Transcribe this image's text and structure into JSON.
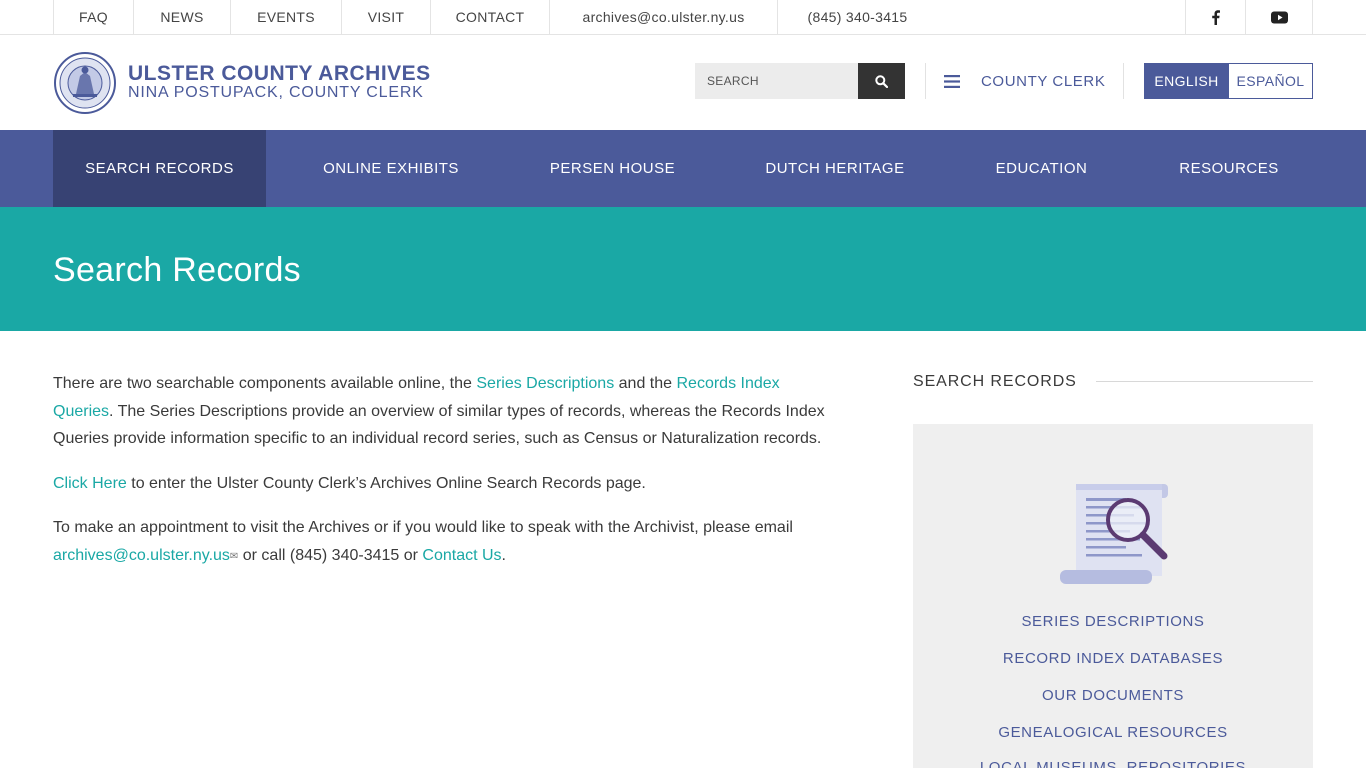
{
  "topbar": {
    "links": [
      "FAQ",
      "NEWS",
      "EVENTS",
      "VISIT",
      "CONTACT"
    ],
    "email": "archives@co.ulster.ny.us",
    "phone": "(845) 340-3415",
    "social": [
      "facebook-icon",
      "youtube-icon"
    ]
  },
  "header": {
    "title": "ULSTER COUNTY ARCHIVES",
    "subtitle": "NINA POSTUPACK, COUNTY CLERK",
    "search_placeholder": "SEARCH",
    "county_clerk_label": "COUNTY CLERK",
    "lang_english": "ENGLISH",
    "lang_spanish": "ESPAÑOL"
  },
  "nav": {
    "items": [
      "SEARCH RECORDS",
      "ONLINE EXHIBITS",
      "PERSEN HOUSE",
      "DUTCH HERITAGE",
      "EDUCATION",
      "RESOURCES"
    ],
    "active": "SEARCH RECORDS"
  },
  "banner": {
    "title": "Search Records"
  },
  "content": {
    "p1_a": "There are two searchable components available online, the ",
    "p1_link1": "Series Descriptions",
    "p1_b": " and the ",
    "p1_link2": "Records Index Queries",
    "p1_c": ". The Series Descriptions provide an overview of similar types of records, whereas the Records Index Queries provide information specific to an individual record series, such as Census or Naturalization records.",
    "p2_link": "Click Here",
    "p2_text": " to enter the Ulster County Clerk’s Archives Online Search Records page.",
    "p3_a": "To make an appointment to visit the Archives or if you would like to speak with the Archivist, please email ",
    "p3_email": "archives@co.ulster.ny.us",
    "p3_b": " or call (845) 340-3415 or ",
    "p3_contact": "Contact Us",
    "p3_c": "."
  },
  "sidebar": {
    "heading": "SEARCH RECORDS",
    "links": [
      "SERIES DESCRIPTIONS",
      "RECORD INDEX DATABASES",
      "OUR DOCUMENTS",
      "GENEALOGICAL RESOURCES",
      "LOCAL MUSEUMS, REPOSITORIES"
    ]
  },
  "colors": {
    "brand": "#4b5a9a",
    "brand_dark": "#374273",
    "teal": "#1aa8a5",
    "panel": "#efefef"
  }
}
